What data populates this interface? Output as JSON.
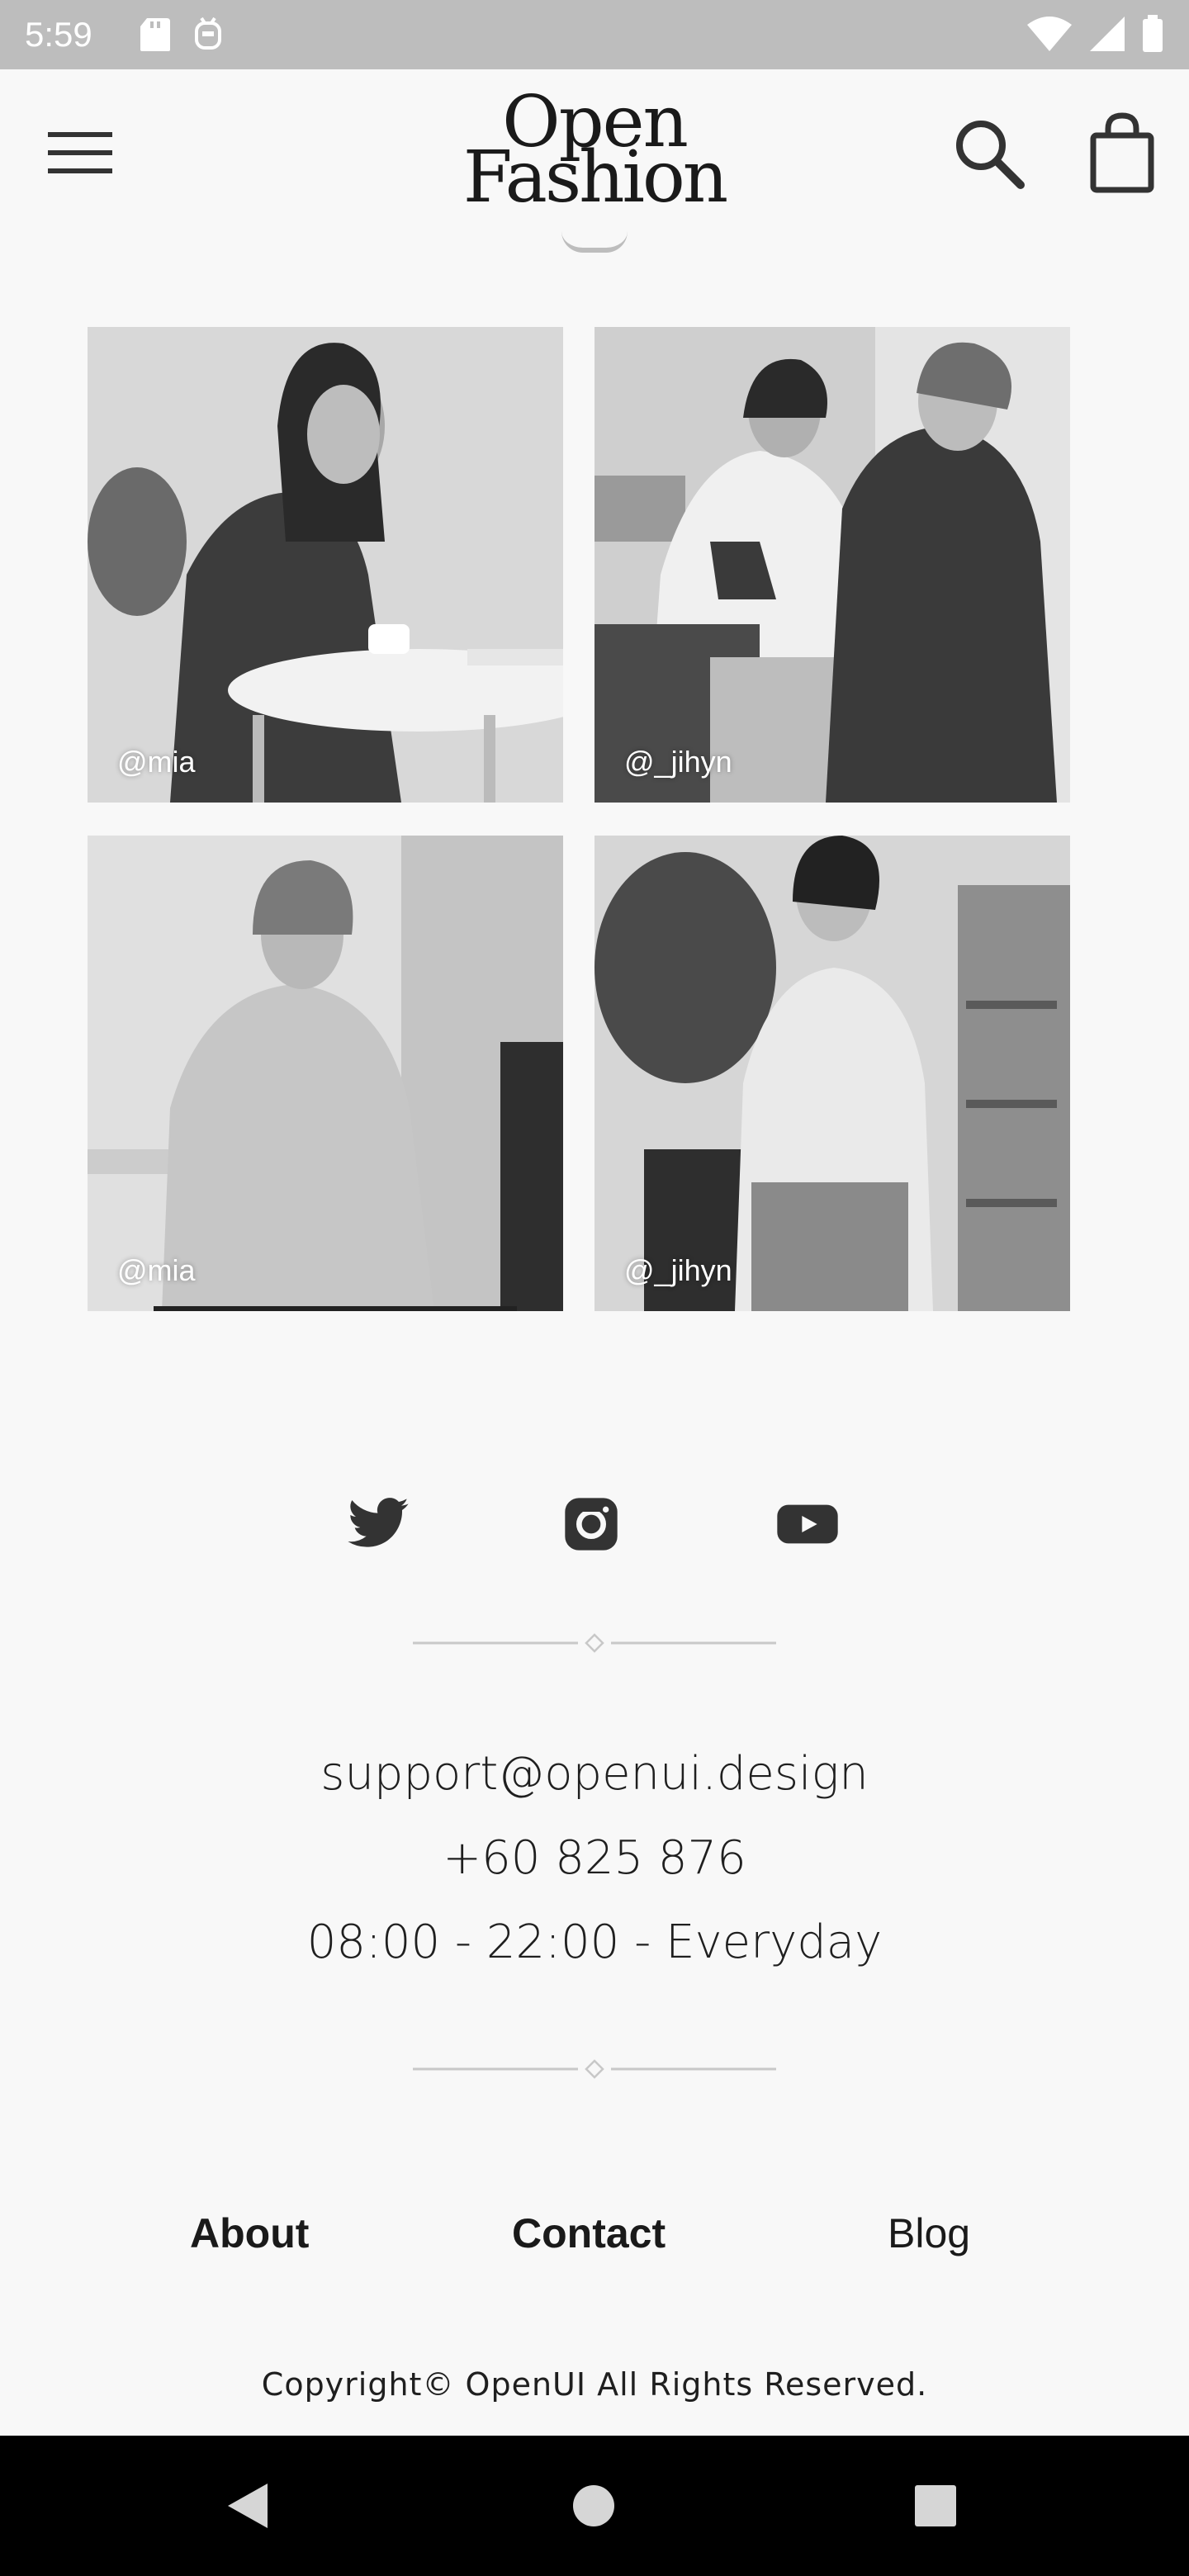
{
  "status_bar": {
    "time": "5:59"
  },
  "header": {
    "logo_line1": "Open",
    "logo_line2": "Fashion"
  },
  "gallery": [
    {
      "handle": "@mia"
    },
    {
      "handle": "@_jihyn"
    },
    {
      "handle": "@mia"
    },
    {
      "handle": "@_jihyn"
    }
  ],
  "social": {
    "icons": [
      "twitter-icon",
      "instagram-icon",
      "youtube-icon"
    ]
  },
  "contact": {
    "email": "support@openui.design",
    "phone": "+60 825 876",
    "hours": "08:00 - 22:00 - Everyday"
  },
  "footer": {
    "about": "About",
    "contact": "Contact",
    "blog": "Blog",
    "copyright": "Copyright© OpenUI All Rights Reserved."
  },
  "colors": {
    "background": "#f8f8f8",
    "status_bar": "#bdbdbd",
    "text": "#1a1a1a",
    "nav_bar": "#000000"
  }
}
